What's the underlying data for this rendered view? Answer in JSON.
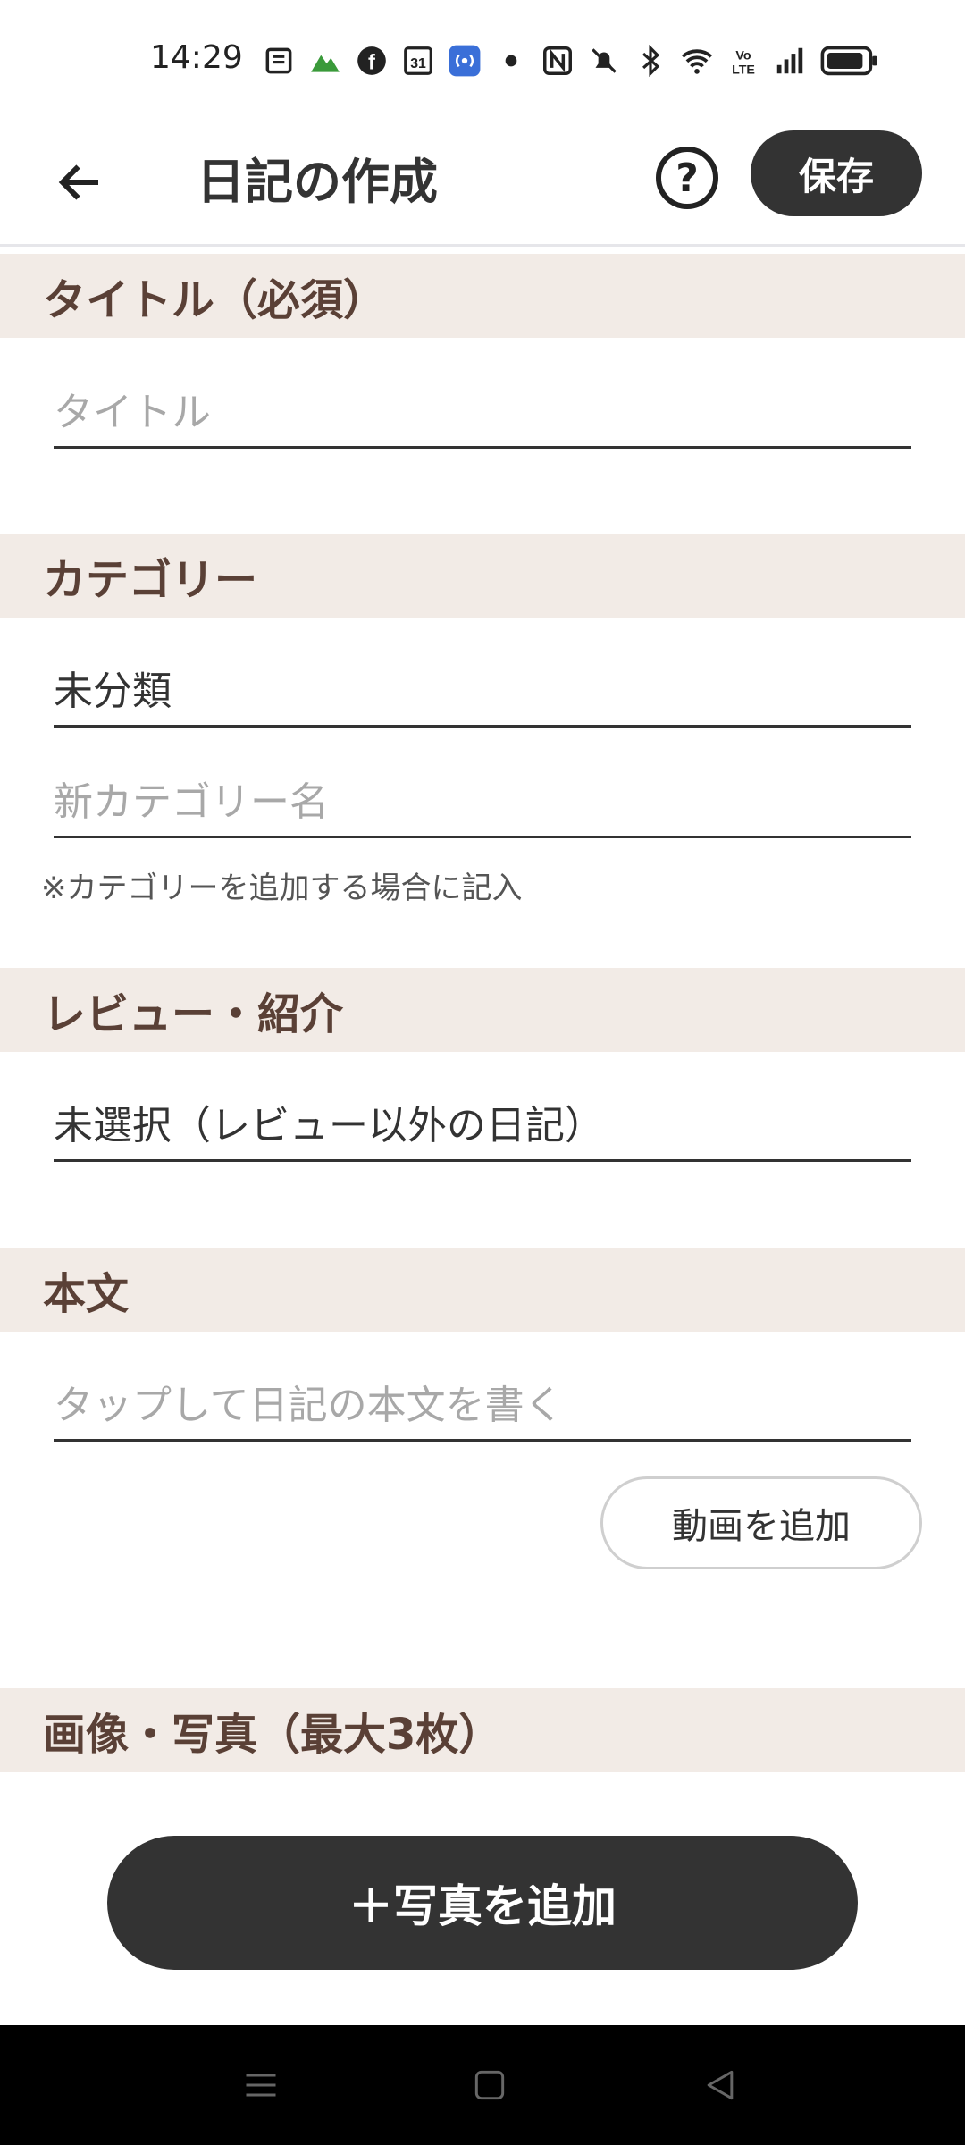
{
  "status_bar": {
    "time": "14:29",
    "icons": [
      "news-icon",
      "mountain-icon",
      "facebook-icon",
      "calendar-icon",
      "broadcast-icon",
      "dot-icon",
      "nfc-icon",
      "mute-icon",
      "bluetooth-icon",
      "wifi-icon",
      "volte-icon",
      "signal-icon",
      "battery-icon"
    ],
    "calendar_text": "31",
    "volte_text": "Vo LTE"
  },
  "app_bar": {
    "title": "日記の作成",
    "help_label": "?",
    "save_label": "保存"
  },
  "sections": {
    "title": {
      "header": "タイトル（必須）",
      "placeholder": "タイトル"
    },
    "category": {
      "header": "カテゴリー",
      "selected": "未分類",
      "new_placeholder": "新カテゴリー名",
      "note": "※カテゴリーを追加する場合に記入"
    },
    "review": {
      "header": "レビュー・紹介",
      "selected": "未選択（レビュー以外の日記）"
    },
    "body": {
      "header": "本文",
      "placeholder": "タップして日記の本文を書く",
      "add_video_label": "動画を追加"
    },
    "images": {
      "header": "画像・写真（最大3枚）",
      "add_photo_label": "＋写真を追加"
    }
  },
  "colors": {
    "section_bg": "#f2ebe6",
    "section_text": "#5a4036",
    "dark_button": "#333333"
  }
}
